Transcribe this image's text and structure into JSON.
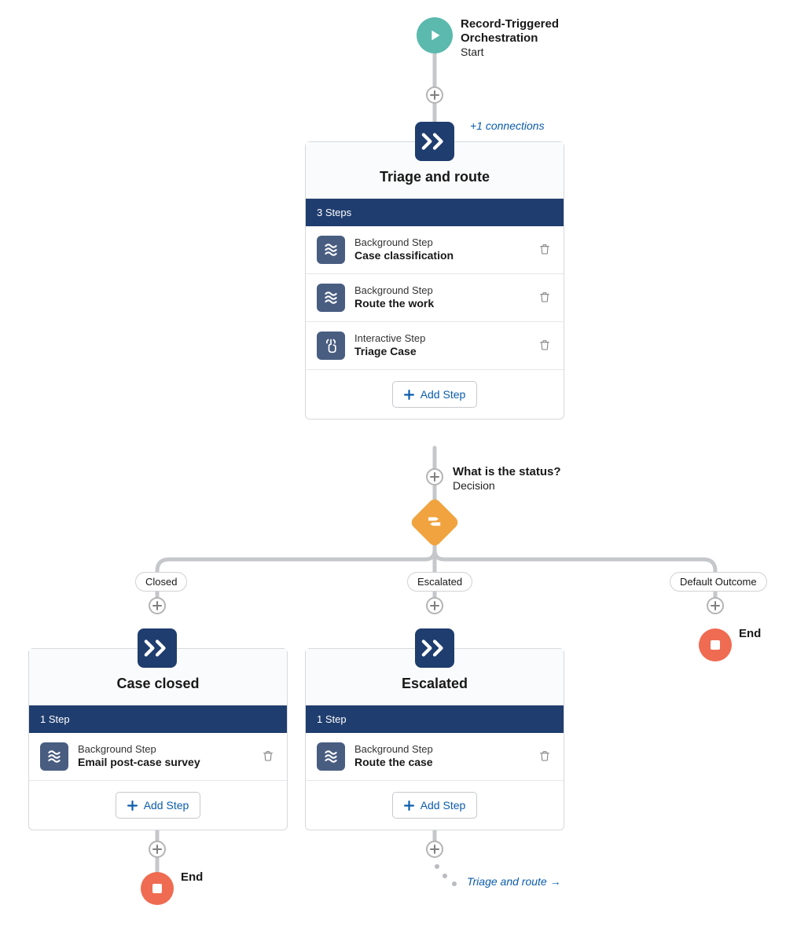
{
  "colors": {
    "accent_blue": "#0b5cab",
    "stage_header": "#1f3d6e",
    "decision": "#f0a33e",
    "end": "#ef6b51",
    "start": "#5bb9ad"
  },
  "start_node": {
    "title_line1": "Record-Triggered",
    "title_line2": "Orchestration",
    "subtitle": "Start"
  },
  "connections_note": "+1 connections",
  "stages": {
    "triage": {
      "title": "Triage and route",
      "step_count_label": "3 Steps",
      "add_step_label": "Add Step",
      "steps": [
        {
          "kind": "Background Step",
          "name": "Case classification",
          "icon": "flow"
        },
        {
          "kind": "Background Step",
          "name": "Route the work",
          "icon": "flow"
        },
        {
          "kind": "Interactive Step",
          "name": "Triage Case",
          "icon": "interactive"
        }
      ]
    },
    "closed": {
      "title": "Case closed",
      "step_count_label": "1 Step",
      "add_step_label": "Add Step",
      "steps": [
        {
          "kind": "Background Step",
          "name": "Email post-case survey",
          "icon": "flow"
        }
      ]
    },
    "escalated": {
      "title": "Escalated",
      "step_count_label": "1 Step",
      "add_step_label": "Add Step",
      "steps": [
        {
          "kind": "Background Step",
          "name": "Route the case",
          "icon": "flow"
        }
      ]
    }
  },
  "decision": {
    "title": "What is the status?",
    "subtitle": "Decision",
    "outcomes": {
      "closed": "Closed",
      "escalated": "Escalated",
      "default": "Default Outcome"
    }
  },
  "end_label": "End",
  "goto_label": "Triage and route →"
}
